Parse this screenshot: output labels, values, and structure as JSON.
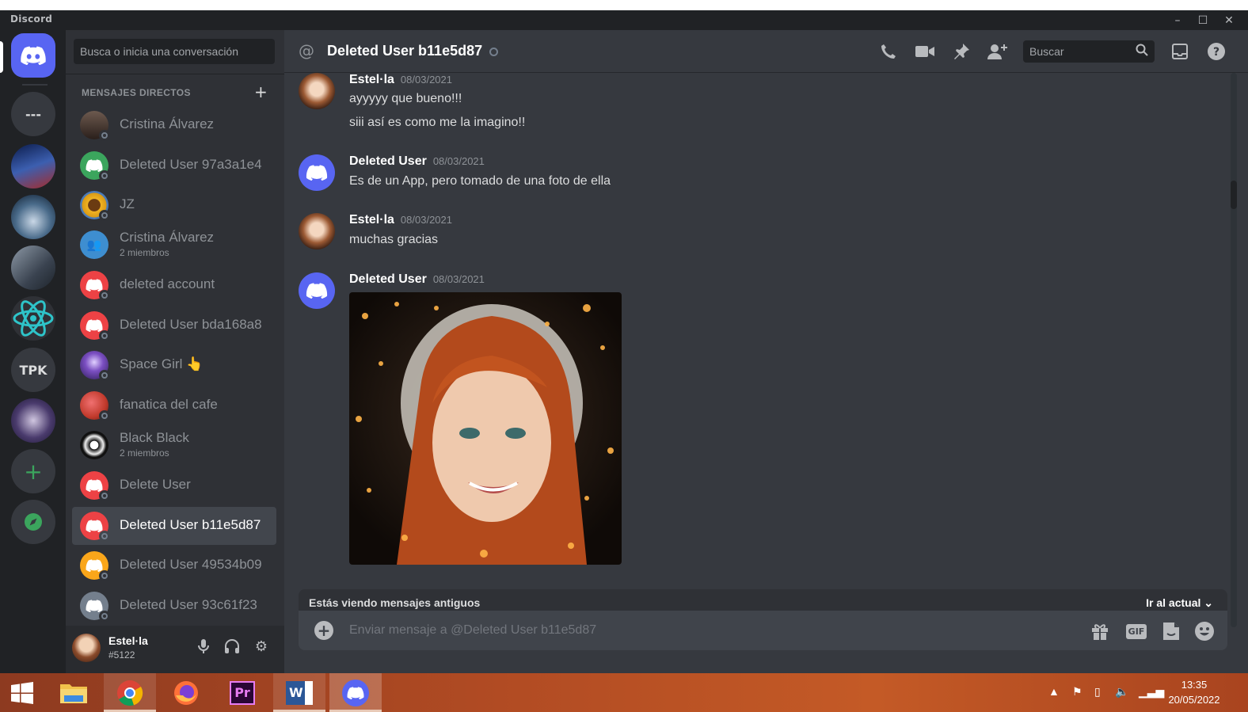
{
  "window": {
    "app_name": "Discord",
    "controls": [
      "–",
      "☐",
      "✕"
    ]
  },
  "colors": {
    "blurple": "#5865f2",
    "red_avatar": "#ed4245",
    "green_avatar": "#3ba55d",
    "yellow_avatar": "#faa61a",
    "grey_avatar": "#747f8d",
    "blue_avatar": "#3e8ed0"
  },
  "servers": [
    {
      "name": "home",
      "icon": "discord-logo-icon"
    },
    {
      "name": "---",
      "label": "---"
    },
    {
      "name": "server-2",
      "icon": "image-icon"
    },
    {
      "name": "server-3",
      "icon": "image-icon"
    },
    {
      "name": "server-4",
      "icon": "image-icon"
    },
    {
      "name": "server-5",
      "icon": "atom-icon"
    },
    {
      "name": "server-tpk",
      "label": "TPK"
    },
    {
      "name": "server-7",
      "icon": "image-icon"
    },
    {
      "name": "add-server",
      "label": "+"
    },
    {
      "name": "explore",
      "icon": "compass-icon"
    }
  ],
  "sidebar": {
    "search_placeholder": "Busca o inicia una conversación",
    "section_title": "MENSAJES DIRECTOS",
    "add_label": "+",
    "items": [
      {
        "name": "Cristina Álvarez",
        "avatar": "photo"
      },
      {
        "name": "Deleted User 97a3a1e4",
        "avatar": "green"
      },
      {
        "name": "JZ",
        "avatar": "sunflower"
      },
      {
        "name": "Cristina Álvarez",
        "sub": "2 miembros",
        "avatar": "blue-group"
      },
      {
        "name": "deleted account",
        "avatar": "red"
      },
      {
        "name": "Deleted User bda168a8",
        "avatar": "red"
      },
      {
        "name": "Space Girl",
        "emoji": "👆",
        "avatar": "purple"
      },
      {
        "name": "fanatica del cafe",
        "avatar": "red-photo"
      },
      {
        "name": "Black Black",
        "sub": "2 miembros",
        "avatar": "group-photo"
      },
      {
        "name": "Delete User",
        "avatar": "red"
      },
      {
        "name": "Deleted User b11e5d87",
        "avatar": "red",
        "selected": true
      },
      {
        "name": "Deleted User 49534b09",
        "avatar": "yellow"
      },
      {
        "name": "Deleted User 93c61f23",
        "avatar": "grey"
      }
    ]
  },
  "user_panel": {
    "name": "Estel·la",
    "tag": "#5122"
  },
  "channel": {
    "at": "@",
    "title": "Deleted User b11e5d87",
    "search_placeholder": "Buscar"
  },
  "messages": [
    {
      "author": "Estel·la",
      "time": "08/03/2021",
      "lines": [
        "ayyyyy que bueno!!!",
        "siii así es como me la imagino!!"
      ],
      "avatar": "photo"
    },
    {
      "author": "Deleted User",
      "time": "08/03/2021",
      "lines": [
        "Es de un App, pero tomado de una foto de ella"
      ],
      "avatar": "blurple"
    },
    {
      "author": "Estel·la",
      "time": "08/03/2021",
      "lines": [
        "muchas gracias"
      ],
      "avatar": "photo"
    },
    {
      "author": "Deleted User",
      "time": "08/03/2021",
      "lines": [],
      "attachment": "portrait-image",
      "avatar": "blurple"
    }
  ],
  "old_messages_bar": {
    "text": "Estás viendo mensajes antiguos",
    "jump": "Ir al actual"
  },
  "composer": {
    "placeholder": "Enviar mensaje a @Deleted User b11e5d87",
    "gif_label": "GIF"
  },
  "taskbar": {
    "apps": [
      "windows-start",
      "file-explorer",
      "chrome",
      "firefox",
      "premiere-pro",
      "word",
      "discord"
    ],
    "premiere_label": "Pr",
    "word_label": "W",
    "time": "13:35",
    "date": "20/05/2022"
  }
}
